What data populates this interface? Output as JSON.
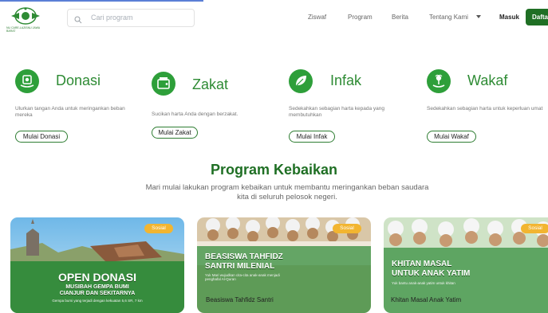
{
  "header": {
    "logo_subtext": "NU CARE-LAZISNU JAWA BARAT",
    "search_placeholder": "Cari program",
    "nav": {
      "ziswaf": "Ziswaf",
      "program": "Program",
      "berita": "Berita",
      "tentang": "Tentang Kami"
    },
    "masuk": "Masuk",
    "daftar": "Daftar"
  },
  "services": [
    {
      "title": "Donasi",
      "desc": "Ulurkan tangan Anda untuk meringankan beban mereka",
      "button": "Mulai Donasi",
      "icon": "hand-coin-icon"
    },
    {
      "title": "Zakat",
      "desc": "Sucikan harta Anda dengan berzakat.",
      "button": "Mulai Zakat",
      "icon": "wallet-icon"
    },
    {
      "title": "Infak",
      "desc": "Sedekahkan sebagian harta kepada yang membutuhkan",
      "button": "Mulai Infak",
      "icon": "leaf-hand-icon"
    },
    {
      "title": "Wakaf",
      "desc": "Sedekahkan sebagian harta untuk keperluan umat",
      "button": "Mulai Wakaf",
      "icon": "plant-hand-icon"
    }
  ],
  "section": {
    "title": "Program Kebaikan",
    "subtitle": "Mari mulai lakukan program kebaikan untuk membantu meringankan beban saudara kita di seluruh pelosok negeri."
  },
  "programs": [
    {
      "badge": "Sosial",
      "headline_1": "OPEN DONASI",
      "headline_2": "MUSIBAH GEMPA BUMI",
      "headline_3": "CIANJUR DAN SEKITARNYA",
      "small": "Gempa bumi yang terjadi dengan kekuatan 5,6 SR, 7 km",
      "title": ""
    },
    {
      "badge": "Sosial",
      "headline_1": "BEASISWA TAHFIDZ",
      "headline_2": "SANTRI MILENIAL",
      "small": "Yuk Mari wujudkan cita-cita anak-anak menjadi penghafal Al-Quran",
      "title": "Beasiswa Tahfidz Santri"
    },
    {
      "badge": "Sosial",
      "headline_1": "KHITAN MASAL",
      "headline_2": "UNTUK ANAK YATIM",
      "small": "Yuk bantu anak-anak yatim untuk khitan",
      "title": "Khitan Masal Anak Yatim"
    }
  ],
  "colors": {
    "brand_green": "#1f6f24",
    "icon_green": "#2e9f3a",
    "badge_orange": "#f2b531"
  }
}
